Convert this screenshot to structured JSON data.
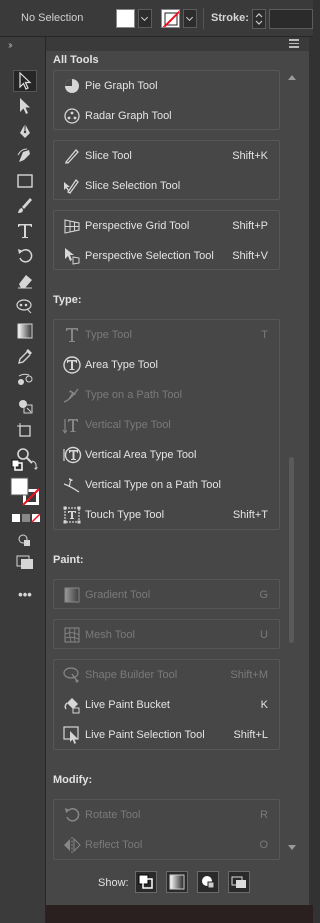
{
  "control_bar": {
    "selection_status": "No Selection",
    "stroke_label": "Stroke:"
  },
  "toolbar": {
    "tools": [
      "selection-tool",
      "direct-selection-tool",
      "pen-tool",
      "curvature-tool",
      "rectangle-tool",
      "paintbrush-tool",
      "type-tool",
      "rotate-tool",
      "eraser-tool",
      "puppet-warp-tool",
      "gradient-tool",
      "eyedropper-tool",
      "blend-tool",
      "shape-builder-tool",
      "artboard-tool",
      "zoom-tool"
    ],
    "more_label": "•••"
  },
  "panel": {
    "title": "All Tools",
    "groups_top": [
      {
        "tools": [
          {
            "name": "Pie Graph Tool",
            "shortcut": "",
            "icon": "pie-graph-icon"
          },
          {
            "name": "Radar Graph Tool",
            "shortcut": "",
            "icon": "radar-graph-icon"
          }
        ]
      },
      {
        "tools": [
          {
            "name": "Slice Tool",
            "shortcut": "Shift+K",
            "icon": "slice-icon"
          },
          {
            "name": "Slice Selection Tool",
            "shortcut": "",
            "icon": "slice-selection-icon"
          }
        ]
      },
      {
        "tools": [
          {
            "name": "Perspective Grid Tool",
            "shortcut": "Shift+P",
            "icon": "perspective-grid-icon"
          },
          {
            "name": "Perspective Selection Tool",
            "shortcut": "Shift+V",
            "icon": "perspective-selection-icon"
          }
        ]
      }
    ],
    "type_section": {
      "title": "Type:",
      "tools": [
        {
          "name": "Type Tool",
          "shortcut": "T",
          "dim": true
        },
        {
          "name": "Area Type Tool",
          "shortcut": "",
          "dim": false
        },
        {
          "name": "Type on a Path Tool",
          "shortcut": "",
          "dim": true
        },
        {
          "name": "Vertical Type Tool",
          "shortcut": "",
          "dim": true
        },
        {
          "name": "Vertical Area Type Tool",
          "shortcut": "",
          "dim": false
        },
        {
          "name": "Vertical Type on a Path Tool",
          "shortcut": "",
          "dim": false
        },
        {
          "name": "Touch Type Tool",
          "shortcut": "Shift+T",
          "dim": false
        }
      ]
    },
    "paint_section": {
      "title": "Paint:",
      "tools": [
        {
          "name": "Gradient Tool",
          "shortcut": "G",
          "dim": true
        },
        {
          "name": "Mesh Tool",
          "shortcut": "U",
          "dim": true
        },
        {
          "name": "Shape Builder Tool",
          "shortcut": "Shift+M",
          "dim": true
        },
        {
          "name": "Live Paint Bucket",
          "shortcut": "K",
          "dim": false
        },
        {
          "name": "Live Paint Selection Tool",
          "shortcut": "Shift+L",
          "dim": false
        }
      ]
    },
    "modify_section": {
      "title": "Modify:",
      "tools": [
        {
          "name": "Rotate Tool",
          "shortcut": "R",
          "dim": true
        },
        {
          "name": "Reflect Tool",
          "shortcut": "O",
          "dim": true
        }
      ]
    },
    "show_label": "Show:"
  }
}
